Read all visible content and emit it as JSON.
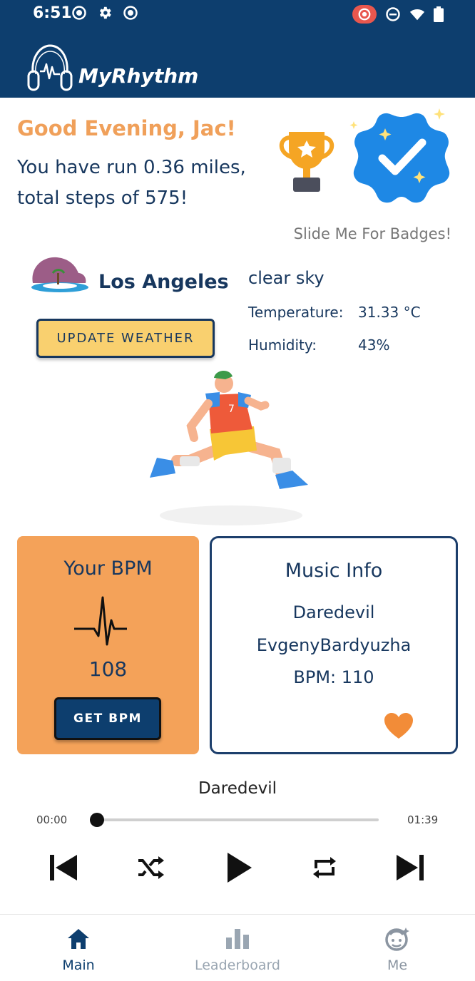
{
  "status_bar": {
    "time": "6:51",
    "left_icons": [
      "record-icon",
      "gear-icon",
      "record-icon"
    ],
    "right_icons": [
      "screen-record-icon",
      "do-not-disturb-icon",
      "wifi-icon",
      "battery-icon"
    ]
  },
  "header": {
    "app_title": "MyRhythm",
    "logo_icon": "headphones-logo-icon",
    "brand_color": "#0d3e6e"
  },
  "greeting": {
    "title": "Good Evening, Jac!",
    "run_summary": "You have run 0.36 miles, total steps of 575!",
    "slide_hint": "Slide Me For Badges!",
    "accent_color": "#f0a05a"
  },
  "weather": {
    "city": "Los Angeles",
    "condition": "clear sky",
    "temperature_label": "Temperature:",
    "temperature_value": "31.33 °C",
    "humidity_label": "Humidity:",
    "humidity_value": "43%",
    "update_button": "UPDATE WEATHER"
  },
  "bpm_card": {
    "title": "Your BPM",
    "value": "108",
    "button": "GET BPM",
    "card_color": "#f4a259"
  },
  "music_card": {
    "title": "Music Info",
    "song": "Daredevil",
    "artist": "EvgenyBardyuzha",
    "bpm": "BPM: 110",
    "heart_color": "#f28c38"
  },
  "player": {
    "song_title": "Daredevil",
    "time_elapsed": "00:00",
    "time_total": "01:39",
    "progress": 0
  },
  "bottom_nav": {
    "items": [
      {
        "label": "Main",
        "icon": "home-icon",
        "active": true
      },
      {
        "label": "Leaderboard",
        "icon": "bar-chart-icon",
        "active": false
      },
      {
        "label": "Me",
        "icon": "face-icon",
        "active": false
      }
    ]
  }
}
